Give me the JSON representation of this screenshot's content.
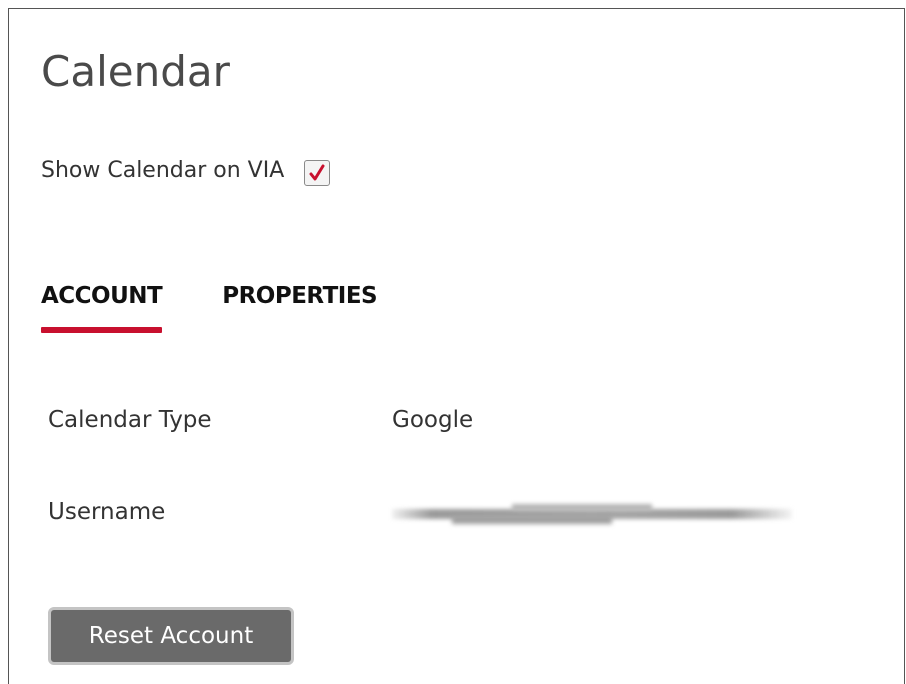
{
  "header": {
    "title": "Calendar"
  },
  "settings": {
    "show_calendar_label": "Show Calendar on VIA",
    "show_calendar_checked": true
  },
  "tabs": [
    {
      "label": "ACCOUNT",
      "active": true
    },
    {
      "label": "PROPERTIES",
      "active": false
    }
  ],
  "account": {
    "fields": [
      {
        "label": "Calendar Type",
        "value": "Google"
      },
      {
        "label": "Username",
        "value": ""
      }
    ],
    "reset_label": "Reset Account"
  },
  "colors": {
    "accent": "#c8102e",
    "button_bg": "#6a6a6a"
  },
  "icons": {
    "checkbox_mark": "checkmark-icon"
  }
}
